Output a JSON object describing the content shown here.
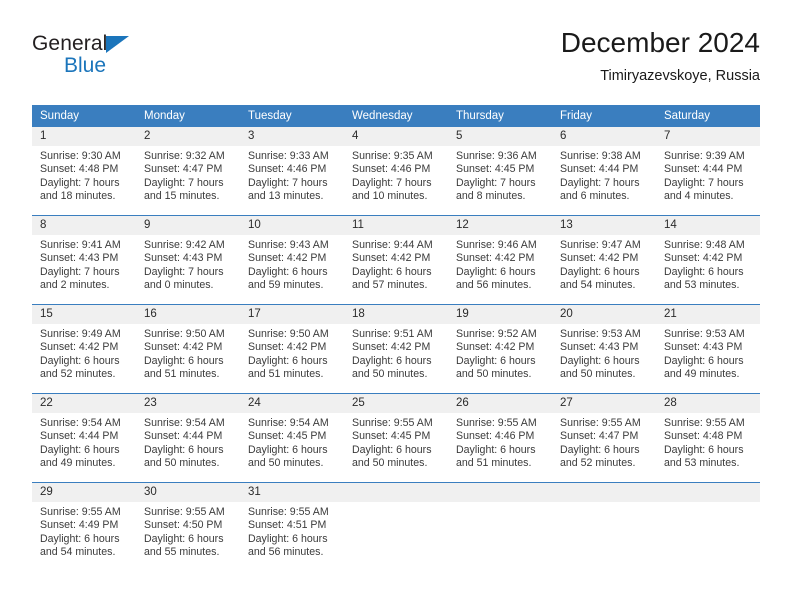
{
  "brand": {
    "name_part1": "General",
    "name_part2": "Blue",
    "triangle_color": "#1b75bb"
  },
  "header": {
    "title": "December 2024",
    "subtitle": "Timiryazevskoye, Russia"
  },
  "theme": {
    "header_bg": "#3a7ebf",
    "header_text": "#ffffff",
    "daynum_bg": "#f0f0f0",
    "cell_bg": "#ffffff",
    "text": "#3b3b3b"
  },
  "weekday_headers": [
    "Sunday",
    "Monday",
    "Tuesday",
    "Wednesday",
    "Thursday",
    "Friday",
    "Saturday"
  ],
  "weeks": [
    [
      {
        "day": "1",
        "sunrise": "Sunrise: 9:30 AM",
        "sunset": "Sunset: 4:48 PM",
        "daylight1": "Daylight: 7 hours",
        "daylight2": "and 18 minutes."
      },
      {
        "day": "2",
        "sunrise": "Sunrise: 9:32 AM",
        "sunset": "Sunset: 4:47 PM",
        "daylight1": "Daylight: 7 hours",
        "daylight2": "and 15 minutes."
      },
      {
        "day": "3",
        "sunrise": "Sunrise: 9:33 AM",
        "sunset": "Sunset: 4:46 PM",
        "daylight1": "Daylight: 7 hours",
        "daylight2": "and 13 minutes."
      },
      {
        "day": "4",
        "sunrise": "Sunrise: 9:35 AM",
        "sunset": "Sunset: 4:46 PM",
        "daylight1": "Daylight: 7 hours",
        "daylight2": "and 10 minutes."
      },
      {
        "day": "5",
        "sunrise": "Sunrise: 9:36 AM",
        "sunset": "Sunset: 4:45 PM",
        "daylight1": "Daylight: 7 hours",
        "daylight2": "and 8 minutes."
      },
      {
        "day": "6",
        "sunrise": "Sunrise: 9:38 AM",
        "sunset": "Sunset: 4:44 PM",
        "daylight1": "Daylight: 7 hours",
        "daylight2": "and 6 minutes."
      },
      {
        "day": "7",
        "sunrise": "Sunrise: 9:39 AM",
        "sunset": "Sunset: 4:44 PM",
        "daylight1": "Daylight: 7 hours",
        "daylight2": "and 4 minutes."
      }
    ],
    [
      {
        "day": "8",
        "sunrise": "Sunrise: 9:41 AM",
        "sunset": "Sunset: 4:43 PM",
        "daylight1": "Daylight: 7 hours",
        "daylight2": "and 2 minutes."
      },
      {
        "day": "9",
        "sunrise": "Sunrise: 9:42 AM",
        "sunset": "Sunset: 4:43 PM",
        "daylight1": "Daylight: 7 hours",
        "daylight2": "and 0 minutes."
      },
      {
        "day": "10",
        "sunrise": "Sunrise: 9:43 AM",
        "sunset": "Sunset: 4:42 PM",
        "daylight1": "Daylight: 6 hours",
        "daylight2": "and 59 minutes."
      },
      {
        "day": "11",
        "sunrise": "Sunrise: 9:44 AM",
        "sunset": "Sunset: 4:42 PM",
        "daylight1": "Daylight: 6 hours",
        "daylight2": "and 57 minutes."
      },
      {
        "day": "12",
        "sunrise": "Sunrise: 9:46 AM",
        "sunset": "Sunset: 4:42 PM",
        "daylight1": "Daylight: 6 hours",
        "daylight2": "and 56 minutes."
      },
      {
        "day": "13",
        "sunrise": "Sunrise: 9:47 AM",
        "sunset": "Sunset: 4:42 PM",
        "daylight1": "Daylight: 6 hours",
        "daylight2": "and 54 minutes."
      },
      {
        "day": "14",
        "sunrise": "Sunrise: 9:48 AM",
        "sunset": "Sunset: 4:42 PM",
        "daylight1": "Daylight: 6 hours",
        "daylight2": "and 53 minutes."
      }
    ],
    [
      {
        "day": "15",
        "sunrise": "Sunrise: 9:49 AM",
        "sunset": "Sunset: 4:42 PM",
        "daylight1": "Daylight: 6 hours",
        "daylight2": "and 52 minutes."
      },
      {
        "day": "16",
        "sunrise": "Sunrise: 9:50 AM",
        "sunset": "Sunset: 4:42 PM",
        "daylight1": "Daylight: 6 hours",
        "daylight2": "and 51 minutes."
      },
      {
        "day": "17",
        "sunrise": "Sunrise: 9:50 AM",
        "sunset": "Sunset: 4:42 PM",
        "daylight1": "Daylight: 6 hours",
        "daylight2": "and 51 minutes."
      },
      {
        "day": "18",
        "sunrise": "Sunrise: 9:51 AM",
        "sunset": "Sunset: 4:42 PM",
        "daylight1": "Daylight: 6 hours",
        "daylight2": "and 50 minutes."
      },
      {
        "day": "19",
        "sunrise": "Sunrise: 9:52 AM",
        "sunset": "Sunset: 4:42 PM",
        "daylight1": "Daylight: 6 hours",
        "daylight2": "and 50 minutes."
      },
      {
        "day": "20",
        "sunrise": "Sunrise: 9:53 AM",
        "sunset": "Sunset: 4:43 PM",
        "daylight1": "Daylight: 6 hours",
        "daylight2": "and 50 minutes."
      },
      {
        "day": "21",
        "sunrise": "Sunrise: 9:53 AM",
        "sunset": "Sunset: 4:43 PM",
        "daylight1": "Daylight: 6 hours",
        "daylight2": "and 49 minutes."
      }
    ],
    [
      {
        "day": "22",
        "sunrise": "Sunrise: 9:54 AM",
        "sunset": "Sunset: 4:44 PM",
        "daylight1": "Daylight: 6 hours",
        "daylight2": "and 49 minutes."
      },
      {
        "day": "23",
        "sunrise": "Sunrise: 9:54 AM",
        "sunset": "Sunset: 4:44 PM",
        "daylight1": "Daylight: 6 hours",
        "daylight2": "and 50 minutes."
      },
      {
        "day": "24",
        "sunrise": "Sunrise: 9:54 AM",
        "sunset": "Sunset: 4:45 PM",
        "daylight1": "Daylight: 6 hours",
        "daylight2": "and 50 minutes."
      },
      {
        "day": "25",
        "sunrise": "Sunrise: 9:55 AM",
        "sunset": "Sunset: 4:45 PM",
        "daylight1": "Daylight: 6 hours",
        "daylight2": "and 50 minutes."
      },
      {
        "day": "26",
        "sunrise": "Sunrise: 9:55 AM",
        "sunset": "Sunset: 4:46 PM",
        "daylight1": "Daylight: 6 hours",
        "daylight2": "and 51 minutes."
      },
      {
        "day": "27",
        "sunrise": "Sunrise: 9:55 AM",
        "sunset": "Sunset: 4:47 PM",
        "daylight1": "Daylight: 6 hours",
        "daylight2": "and 52 minutes."
      },
      {
        "day": "28",
        "sunrise": "Sunrise: 9:55 AM",
        "sunset": "Sunset: 4:48 PM",
        "daylight1": "Daylight: 6 hours",
        "daylight2": "and 53 minutes."
      }
    ],
    [
      {
        "day": "29",
        "sunrise": "Sunrise: 9:55 AM",
        "sunset": "Sunset: 4:49 PM",
        "daylight1": "Daylight: 6 hours",
        "daylight2": "and 54 minutes."
      },
      {
        "day": "30",
        "sunrise": "Sunrise: 9:55 AM",
        "sunset": "Sunset: 4:50 PM",
        "daylight1": "Daylight: 6 hours",
        "daylight2": "and 55 minutes."
      },
      {
        "day": "31",
        "sunrise": "Sunrise: 9:55 AM",
        "sunset": "Sunset: 4:51 PM",
        "daylight1": "Daylight: 6 hours",
        "daylight2": "and 56 minutes."
      },
      {
        "day": "",
        "sunrise": "",
        "sunset": "",
        "daylight1": "",
        "daylight2": ""
      },
      {
        "day": "",
        "sunrise": "",
        "sunset": "",
        "daylight1": "",
        "daylight2": ""
      },
      {
        "day": "",
        "sunrise": "",
        "sunset": "",
        "daylight1": "",
        "daylight2": ""
      },
      {
        "day": "",
        "sunrise": "",
        "sunset": "",
        "daylight1": "",
        "daylight2": ""
      }
    ]
  ]
}
